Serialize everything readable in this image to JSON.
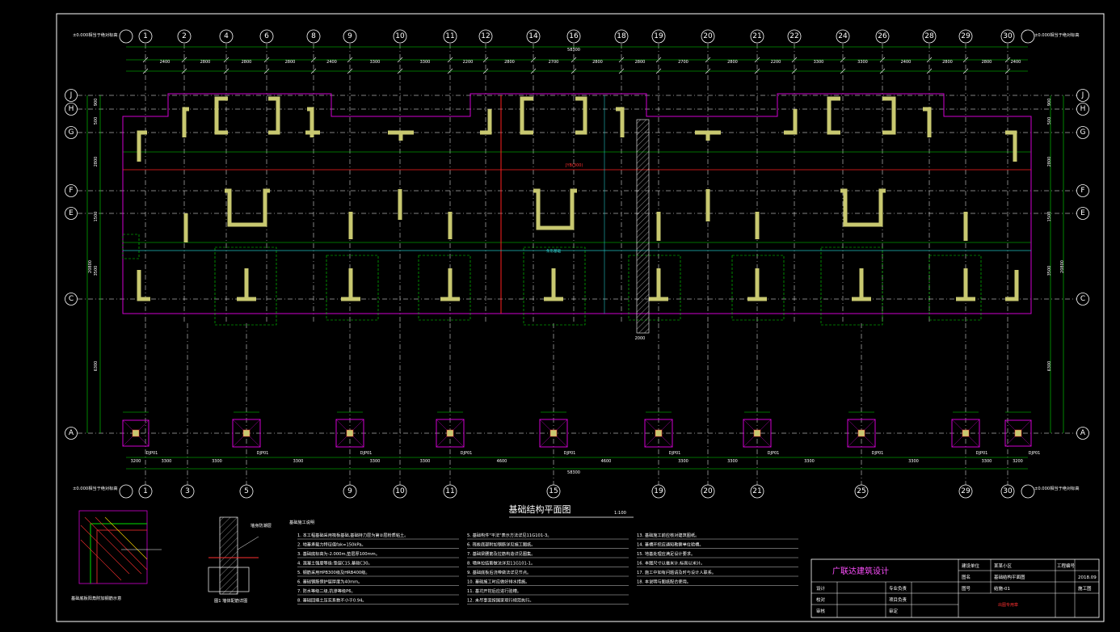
{
  "drawing": {
    "title": "基础结构平面图",
    "scale": "1:100",
    "bg_color": "#000000",
    "grid_color": "#ffffff",
    "dim_color": "#00e000",
    "outline_color": "#d000d0",
    "wall_color": "#c8c870"
  },
  "axes_top": [
    "1",
    "2",
    "4",
    "6",
    "8",
    "9",
    "10",
    "11",
    "12",
    "14",
    "16",
    "18",
    "19",
    "20",
    "21",
    "22",
    "24",
    "26",
    "28",
    "29",
    "30"
  ],
  "axes_bottom": [
    "1",
    "3",
    "5",
    "9",
    "10",
    "11",
    "15",
    "19",
    "20",
    "21",
    "25",
    "29",
    "30"
  ],
  "axes_rows": [
    "J",
    "H",
    "G",
    "F",
    "E",
    "C",
    "A"
  ],
  "dims": {
    "top_total": "58300",
    "bottom_total": "58300",
    "left_total": "20800",
    "right_total": "20800",
    "bottom_spans": [
      "3200",
      "3300",
      "3300",
      "3300",
      "3300",
      "3300",
      "4600",
      "4600",
      "3300",
      "3300",
      "3300",
      "3300",
      "3300",
      "3200"
    ],
    "left_rows": [
      "900",
      "500",
      "2800",
      "1500",
      "3500",
      "6300"
    ],
    "tick_labels": [
      "2400",
      "2800",
      "2800",
      "2800",
      "2400",
      "3300",
      "3300",
      "2200",
      "2800",
      "2700",
      "2800",
      "2800",
      "2700",
      "2800",
      "2200",
      "3300",
      "3300",
      "2400",
      "2800",
      "2800",
      "2400"
    ],
    "pad_label": "2000"
  },
  "annotations": {
    "left_top": "±0.000相当于绝对标高",
    "right_top": "±0.000相当于绝对标高",
    "left_bottom": "±0.000相当于绝对标高",
    "right_bottom": "±0.000相当于绝对标高",
    "red_note": "JYB(300)",
    "cyan_note": "条形基础",
    "pile_label": "DJP01",
    "wall_label": "基础墙"
  },
  "details": {
    "detail1_caption": "基础底板阳角附加钢筋示意",
    "detail2_caption": "图1 墙体配筋详图",
    "detail2_note": "墙身防潮层"
  },
  "notes": {
    "heading": "基础施工说明",
    "col1": [
      "1. 本工程基础采用筏板基础,基础持力层为第②层粉质粘土。",
      "2. 地基承载力特征值fak=150kPa。",
      "3. 基础底标高为-2.000m,垫层厚100mm。",
      "4. 混凝土强度等级:垫层C15,基础C30。",
      "5. 钢筋采用HPB300级及HRB400级。",
      "6. 基础钢筋保护层厚度为40mm。",
      "7. 防水等级二级,抗渗等级P6。",
      "8. 基础回填土压实系数不小于0.94。"
    ],
    "col2": [
      "5. 基础构件\"平法\"表示方法详见11G101-3。",
      "6. 筏板底部附加钢筋详见施工图纸。",
      "7. 基础梁腰筋及拉筋构造详见图集。",
      "8. 墙体拉结筋做法详见11G101-1。",
      "9. 基础底板后浇带做法详见节点。",
      "10. 基础施工时应做好排水措施。",
      "11. 基坑开挖后应进行验槽。",
      "12. 未尽事宜按国家现行规范执行。"
    ],
    "col3": [
      "13. 基础施工前应核对建筑图纸。",
      "14. 基槽开挖应通知勘察单位验槽。",
      "15. 地基处理应满足设计要求。",
      "16. 本图尺寸以毫米计,标高以米计。",
      "17. 施工中如有问题请及时与设计人联系。",
      "18. 本说明与图纸配合使用。"
    ]
  },
  "title_block": {
    "company": "广联达建筑设计",
    "project_label": "建设单位",
    "project_value": "某某小区",
    "drawing_label": "图名",
    "drawing_value": "基础结构平面图",
    "sheet_label": "图号",
    "sheet_value": "结施-01",
    "rows_left": [
      "设计",
      "校对",
      "审核"
    ],
    "rows_mid": [
      "专业负责",
      "项目负责",
      "审定"
    ],
    "code": "工程编号",
    "date": "2018.09",
    "stage": "施工图",
    "red_stamp": "出图专用章"
  }
}
